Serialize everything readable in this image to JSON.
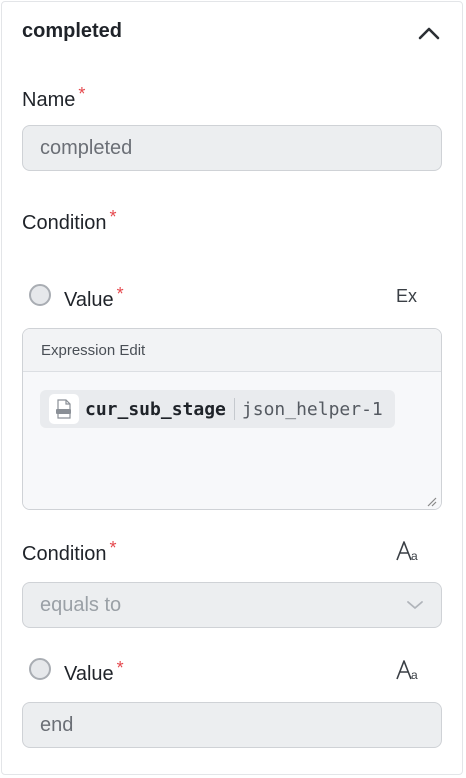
{
  "section": {
    "title": "completed"
  },
  "name": {
    "label": "Name",
    "required": "*",
    "value": "completed"
  },
  "condition": {
    "label": "Condition",
    "required": "*"
  },
  "value_left": {
    "label": "Value",
    "required": "*",
    "mode_button": "Ex"
  },
  "expression_editor": {
    "header": "Expression Edit",
    "token": {
      "variable": "cur_sub_stage",
      "source": "json_helper-1",
      "icon": "json-file-icon"
    }
  },
  "operator": {
    "label": "Condition",
    "required": "*",
    "selected": "equals to",
    "mode_icon": "text-mode-icon"
  },
  "value_right": {
    "label": "Value",
    "required": "*",
    "value": "end",
    "mode_icon": "text-mode-icon"
  },
  "colors": {
    "required": "#e5484d",
    "field_bg": "#eceef0",
    "border": "#cfd2d6"
  }
}
